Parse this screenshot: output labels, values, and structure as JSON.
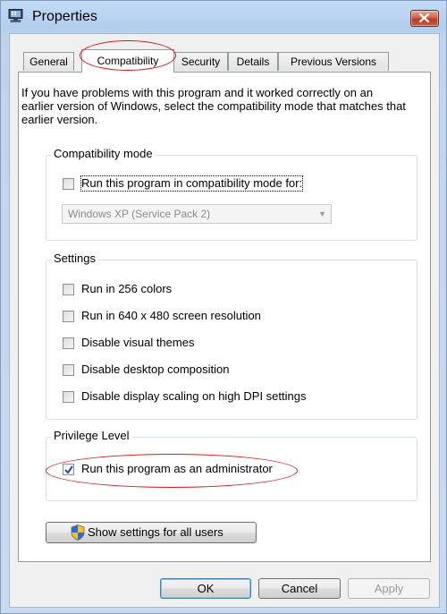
{
  "window": {
    "title": "Properties",
    "title_icon": "computer-icon",
    "close_icon": "close-icon",
    "accent_color": "#c7daf2",
    "annotation_color": "#d2191b"
  },
  "tabs": [
    {
      "label": "General",
      "active": false
    },
    {
      "label": "Compatibility",
      "active": true
    },
    {
      "label": "Security",
      "active": false
    },
    {
      "label": "Details",
      "active": false
    },
    {
      "label": "Previous Versions",
      "active": false
    }
  ],
  "description": "If you have problems with this program and it worked correctly on an earlier version of Windows, select the compatibility mode that matches that earlier version.",
  "compatibility_mode": {
    "legend": "Compatibility mode",
    "checkbox_label": "Run this program in compatibility mode for:",
    "checked": false,
    "select_value": "Windows XP (Service Pack 2)"
  },
  "settings": {
    "legend": "Settings",
    "options": [
      {
        "label": "Run in 256 colors",
        "checked": false
      },
      {
        "label": "Run in 640 x 480 screen resolution",
        "checked": false
      },
      {
        "label": "Disable visual themes",
        "checked": false
      },
      {
        "label": "Disable desktop composition",
        "checked": false
      },
      {
        "label": "Disable display scaling on high DPI settings",
        "checked": false
      }
    ]
  },
  "privilege_level": {
    "legend": "Privilege Level",
    "checkbox_label": "Run this program as an administrator",
    "checked": true
  },
  "show_settings_button": {
    "label": "Show settings for all users",
    "icon": "uac-shield-icon"
  },
  "footer": {
    "ok_label": "OK",
    "cancel_label": "Cancel",
    "apply_label": "Apply"
  }
}
